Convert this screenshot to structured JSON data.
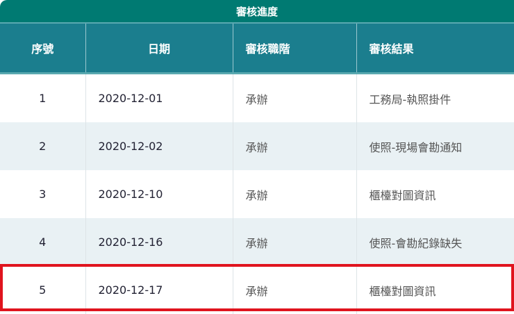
{
  "title": "審核進度",
  "columns": [
    "序號",
    "日期",
    "審核職階",
    "審核結果"
  ],
  "rows": [
    {
      "no": "1",
      "date": "2020-12-01",
      "level": "承辦",
      "result": "工務局-執照掛件"
    },
    {
      "no": "2",
      "date": "2020-12-02",
      "level": "承辦",
      "result": "使照-現場會勘通知"
    },
    {
      "no": "3",
      "date": "2020-12-10",
      "level": "承辦",
      "result": "櫃檯對圖資訊"
    },
    {
      "no": "4",
      "date": "2020-12-16",
      "level": "承辦",
      "result": "使照-會勘紀錄缺失"
    },
    {
      "no": "5",
      "date": "2020-12-17",
      "level": "承辦",
      "result": "櫃檯對圖資訊"
    }
  ],
  "highlight_color": "#e0141e"
}
